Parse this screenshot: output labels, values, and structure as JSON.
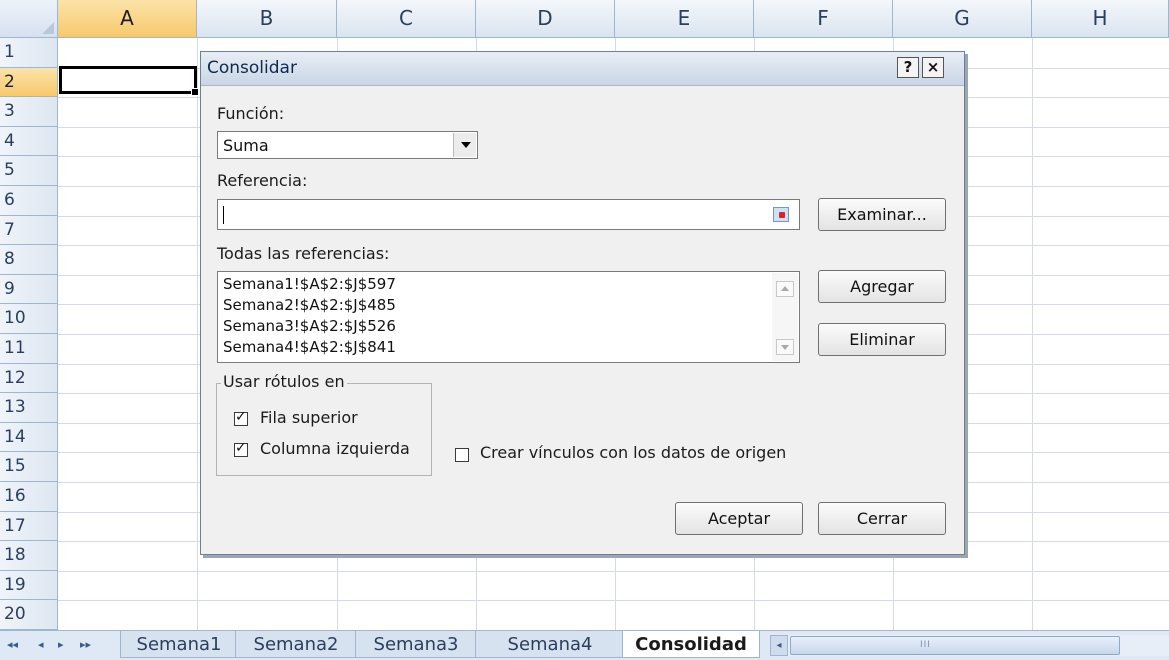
{
  "sheet": {
    "columns": [
      "A",
      "B",
      "C",
      "D",
      "E",
      "F",
      "G",
      "H"
    ],
    "rows": [
      "1",
      "2",
      "3",
      "4",
      "5",
      "6",
      "7",
      "8",
      "9",
      "10",
      "11",
      "12",
      "13",
      "14",
      "15",
      "16",
      "17",
      "18",
      "19",
      "20"
    ],
    "active_row": "2",
    "active_column": "A"
  },
  "tabs": {
    "nav": [
      "◂◂",
      "◂",
      "▸",
      "▸▸"
    ],
    "items": [
      "Semana1",
      "Semana2",
      "Semana3",
      "Semana4",
      "Consolidad"
    ],
    "active": "Consolidad",
    "scroll_grip": "III"
  },
  "dialog": {
    "title": "Consolidar",
    "help_label": "?",
    "close_label": "×",
    "function_label": "Función:",
    "function_value": "Suma",
    "reference_label": "Referencia:",
    "reference_value": "",
    "browse_button": "Examinar...",
    "all_refs_label": "Todas las referencias:",
    "references": [
      "Semana1!$A$2:$J$597",
      "Semana2!$A$2:$J$485",
      "Semana3!$A$2:$J$526",
      "Semana4!$A$2:$J$841"
    ],
    "add_button": "Agregar",
    "delete_button": "Eliminar",
    "labels_group": "Usar rótulos en",
    "top_row_label": "Fila superior",
    "top_row_checked": true,
    "left_column_label": "Columna izquierda",
    "left_column_checked": true,
    "links_label": "Crear vínculos con los datos de origen",
    "links_checked": false,
    "ok_button": "Aceptar",
    "close_button": "Cerrar"
  }
}
